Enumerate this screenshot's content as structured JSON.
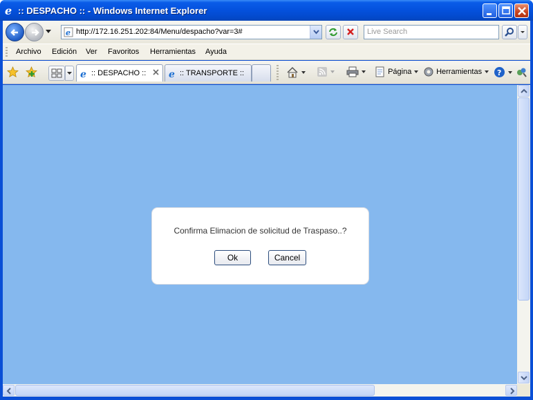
{
  "window": {
    "title": ":: DESPACHO :: - Windows Internet Explorer"
  },
  "address": {
    "url": "http://172.16.251.202:84/Menu/despacho?var=3#",
    "search_placeholder": "Live Search"
  },
  "menu": {
    "items": [
      "Archivo",
      "Edición",
      "Ver",
      "Favoritos",
      "Herramientas",
      "Ayuda"
    ]
  },
  "tabs": [
    {
      "label": ":: DESPACHO ::",
      "active": true
    },
    {
      "label": ":: TRANSPORTE ::",
      "active": false
    }
  ],
  "commands": {
    "page": "Página",
    "tools": "Herramientas"
  },
  "dialog": {
    "message": "Confirma Elimacion de solicitud de Traspaso..?",
    "ok_label": "Ok",
    "cancel_label": "Cancel"
  },
  "colors": {
    "content_bg": "#85b8ee",
    "titlebar": "#0451dd"
  }
}
